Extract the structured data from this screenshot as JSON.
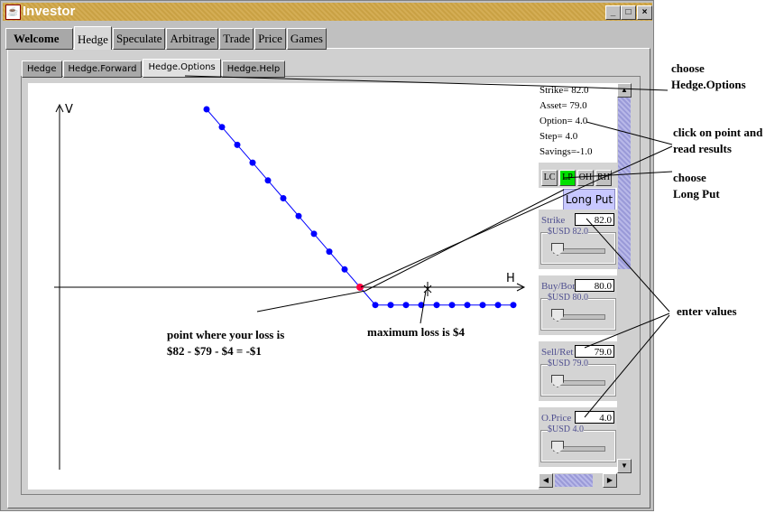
{
  "window": {
    "title": "Investor",
    "controls": [
      "_",
      "□",
      "×"
    ]
  },
  "main_tabs": [
    "Welcome",
    "Hedge",
    "Speculate",
    "Arbitrage",
    "Trade",
    "Price",
    "Games"
  ],
  "main_selected": "Hedge",
  "sub_tabs": [
    "Hedge",
    "Hedge.Forward",
    "Hedge.Options",
    "Hedge.Help"
  ],
  "sub_selected": "Hedge.Options",
  "results": [
    "Strike= 82.0",
    "Asset= 79.0",
    "Option= 4.0",
    "Step= 4.0",
    "Savings=-1.0"
  ],
  "strategy_buttons": [
    {
      "label": "LC",
      "active": false
    },
    {
      "label": "LP",
      "active": true
    },
    {
      "label": "OH",
      "active": false
    },
    {
      "label": "RH",
      "active": false
    }
  ],
  "strategy_name": "Long Put",
  "inputs": [
    {
      "label": "Strike",
      "value": "82.0",
      "slider_caption": "$USD 82.0"
    },
    {
      "label": "Buy/Bor",
      "value": "80.0",
      "slider_caption": "$USD 80.0"
    },
    {
      "label": "Sell/Ret",
      "value": "79.0",
      "slider_caption": "$USD 79.0"
    },
    {
      "label": "O.Price",
      "value": "4.0",
      "slider_caption": "$USD 4.0"
    }
  ],
  "chart_data": {
    "type": "line",
    "xlabel": "H",
    "ylabel": "V",
    "color": "#0000ff",
    "highlight_color": "#ff0040",
    "x": [
      40,
      44,
      48,
      52,
      56,
      60,
      64,
      68,
      72,
      76,
      80,
      84,
      88,
      92,
      96,
      100,
      104,
      108,
      112,
      116,
      120
    ],
    "y": [
      40,
      36,
      32,
      28,
      24,
      20,
      16,
      12,
      8,
      4,
      0,
      -4,
      -4,
      -4,
      -4,
      -4,
      -4,
      -4,
      -4,
      -4,
      -4
    ],
    "highlight_index": 10
  },
  "annotations": {
    "choose_tab": [
      "choose",
      "Hedge.Options"
    ],
    "click_point": [
      "click on point and",
      "read results"
    ],
    "choose_put": [
      "choose",
      "Long Put"
    ],
    "enter_values": "enter values",
    "loss_point": [
      "point where your loss is",
      "$82 - $79 - $4 = -$1"
    ],
    "max_loss": "maximum loss is $4"
  }
}
